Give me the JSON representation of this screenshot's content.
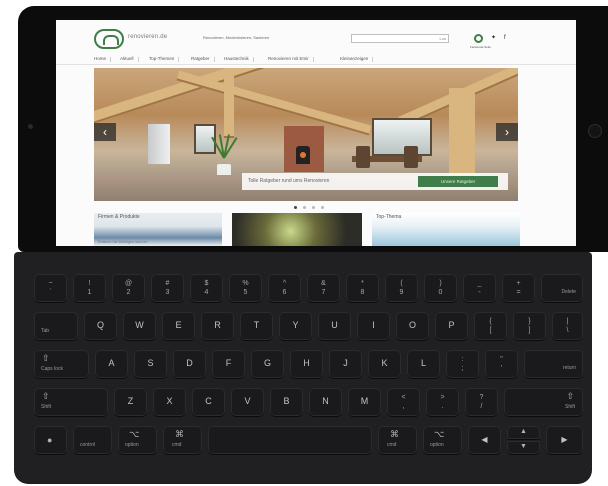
{
  "site": {
    "brand": "renovieren.de",
    "tagline": "Renovieren, Modernisieren, Sanieren",
    "search_label": "Los",
    "social_label": "Facebook-Seite",
    "nav": [
      "Home",
      "Aktuell",
      "Top-Themen",
      "Ratgeber",
      "Haustechnik",
      "Renovieren mit Emir",
      "Kleinanzeigen"
    ],
    "hero_prev": "‹",
    "hero_next": "›",
    "hero_caption": "Tolle Ratgeber rund ums Renovieren",
    "hero_button": "Unsere Ratgeber",
    "teasers": [
      {
        "title": "Firmen & Produkte",
        "line": "Erfahren Sie Wichtiges rund um"
      },
      {
        "title": "",
        "line": ""
      },
      {
        "title": "Top-Thema",
        "line": ""
      }
    ]
  },
  "keyboard": {
    "row1": [
      {
        "top": "~",
        "main": "`"
      },
      {
        "top": "!",
        "main": "1"
      },
      {
        "top": "@",
        "main": "2"
      },
      {
        "top": "#",
        "main": "3"
      },
      {
        "top": "$",
        "main": "4"
      },
      {
        "top": "%",
        "main": "5"
      },
      {
        "top": "^",
        "main": "6"
      },
      {
        "top": "&",
        "main": "7"
      },
      {
        "top": "*",
        "main": "8"
      },
      {
        "top": "(",
        "main": "9"
      },
      {
        "top": ")",
        "main": "0"
      },
      {
        "top": "_",
        "main": "-"
      },
      {
        "top": "+",
        "main": "="
      }
    ],
    "delete": "Delete",
    "tab": "Tab",
    "row2": [
      "Q",
      "W",
      "E",
      "R",
      "T",
      "Y",
      "U",
      "I",
      "O",
      "P"
    ],
    "row2_sym": [
      {
        "top": "{",
        "main": "["
      },
      {
        "top": "}",
        "main": "]"
      },
      {
        "top": "|",
        "main": "\\"
      }
    ],
    "caps": "Caps lock",
    "row3": [
      "A",
      "S",
      "D",
      "F",
      "G",
      "H",
      "J",
      "K",
      "L"
    ],
    "row3_sym": [
      {
        "top": ":",
        "main": ";"
      },
      {
        "top": "\"",
        "main": "'"
      }
    ],
    "return": "return",
    "shift": "Shift",
    "row4": [
      "Z",
      "X",
      "C",
      "V",
      "B",
      "N",
      "M"
    ],
    "row4_sym": [
      {
        "top": "<",
        "main": ","
      },
      {
        "top": ">",
        "main": "."
      },
      {
        "top": "?",
        "main": "/"
      }
    ],
    "control": "control",
    "option": "option",
    "cmd": "cmd",
    "cmd_symbol": "⌘",
    "option_symbol": "⌥",
    "shift_symbol": "⇧",
    "arrows": {
      "left": "◀",
      "up": "▲",
      "down": "▼",
      "right": "▶"
    }
  }
}
